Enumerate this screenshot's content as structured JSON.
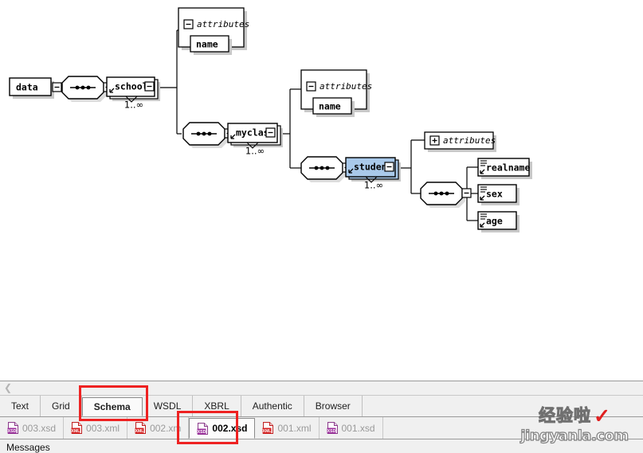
{
  "window": {
    "view": "Schema design view"
  },
  "diagram": {
    "background": "#ffffff",
    "selection_color": "#a9c9ea",
    "nodes": {
      "root": {
        "label": "data",
        "kind": "element"
      },
      "school": {
        "label": "school",
        "kind": "element",
        "occurrence": "1..∞"
      },
      "myclass": {
        "label": "myclass",
        "kind": "element",
        "occurrence": "1..∞"
      },
      "student": {
        "label": "student",
        "kind": "element",
        "occurrence": "1..∞",
        "selected": true
      },
      "realname": {
        "label": "realname",
        "kind": "text-element"
      },
      "sex": {
        "label": "sex",
        "kind": "text-element"
      },
      "age": {
        "label": "age",
        "kind": "text-element"
      }
    },
    "attribute_boxes": [
      {
        "title": "attributes",
        "state": "expanded",
        "toggle": "minus",
        "items": [
          "name"
        ]
      },
      {
        "title": "attributes",
        "state": "expanded",
        "toggle": "minus",
        "items": [
          "name"
        ]
      },
      {
        "title": "attributes",
        "state": "collapsed",
        "toggle": "plus",
        "items": []
      }
    ],
    "compositor_symbol": "sequence"
  },
  "bottom": {
    "scroll_left_icon": "chevron-left-icon",
    "view_tabs": [
      {
        "label": "Text",
        "active": false
      },
      {
        "label": "Grid",
        "active": false
      },
      {
        "label": "Schema",
        "active": true
      },
      {
        "label": "WSDL",
        "active": false
      },
      {
        "label": "XBRL",
        "active": false
      },
      {
        "label": "Authentic",
        "active": false
      },
      {
        "label": "Browser",
        "active": false
      }
    ],
    "file_tabs": [
      {
        "label": "003.xsd",
        "type": "xsd",
        "active": false
      },
      {
        "label": "003.xml",
        "type": "xml",
        "active": false
      },
      {
        "label": "002.xm",
        "type": "xml",
        "active": false
      },
      {
        "label": "002.xsd",
        "type": "xsd",
        "active": true
      },
      {
        "label": "001.xml",
        "type": "xml",
        "active": false
      },
      {
        "label": "001.xsd",
        "type": "xsd",
        "active": false
      }
    ],
    "messages_label": "Messages"
  },
  "annotations": [
    {
      "name": "schema-tab-highlight",
      "color": "#ee2222"
    },
    {
      "name": "file-tab-highlight",
      "color": "#ee2222"
    }
  ],
  "watermark": {
    "cn": "经验啦",
    "check": "✓",
    "en": "jingyanla.com"
  }
}
